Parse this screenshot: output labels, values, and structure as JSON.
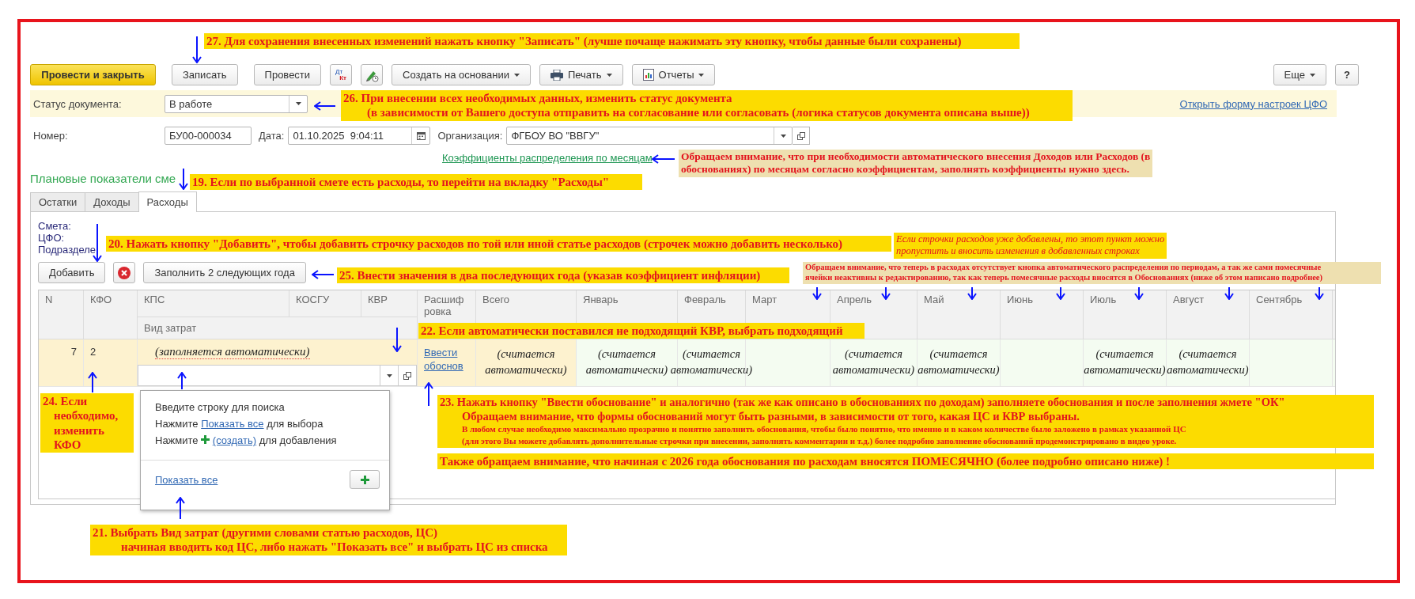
{
  "toolbar": {
    "buttons": [
      {
        "kind": "primary",
        "label": "Провести и закрыть"
      },
      {
        "kind": "plain",
        "label": "Записать"
      },
      {
        "kind": "plain",
        "label": "Провести"
      },
      {
        "kind": "entries",
        "top": "Дт",
        "bottom": "Кт"
      },
      {
        "kind": "pen"
      },
      {
        "kind": "menu",
        "label": "Создать на основании"
      },
      {
        "kind": "print",
        "label": "Печать"
      },
      {
        "kind": "reports",
        "label": "Отчеты"
      }
    ],
    "more": "Еще",
    "help": "?"
  },
  "status": {
    "label": "Статус документа:",
    "value": "В работе",
    "link": "Открыть форму настроек ЦФО"
  },
  "fields": {
    "number": {
      "label": "Номер:",
      "value": "БУ00-000034"
    },
    "date": {
      "label": "Дата:",
      "value": "01.10.2025  9:04:11"
    },
    "organization": {
      "label": "Организация:",
      "value": "ФГБОУ ВО \"ВВГУ\""
    }
  },
  "coefficients_link": "Коэффициенты распределения по месяцам",
  "section_title": "Плановые показатели сме",
  "tabs": [
    {
      "label": "Остатки",
      "selected": false
    },
    {
      "label": "Доходы",
      "selected": false
    },
    {
      "label": "Расходы",
      "selected": true
    }
  ],
  "panel": {
    "labels": [
      "Смета:",
      "ЦФО:",
      "Подразделе"
    ],
    "add_button": "Добавить",
    "fill_button": "Заполнить 2 следующих года"
  },
  "table": {
    "columns": [
      {
        "header": [
          "N"
        ]
      },
      {
        "header": [
          "КФО"
        ]
      },
      {
        "header": [
          "КПС"
        ]
      },
      {
        "header": [
          "КОСГУ"
        ]
      },
      {
        "header": [
          "КВР"
        ]
      },
      {
        "header": [
          "Расшиф",
          "ровка"
        ]
      }
    ],
    "subheader": "Вид затрат",
    "month_columns": [
      {
        "header": "Всего",
        "row_value": "(считается автоматически)"
      },
      {
        "header": "Январь",
        "row_value": "(считается автоматически)"
      },
      {
        "header": "Февраль",
        "row_value": "(считается автоматически)"
      },
      {
        "header": "Март"
      },
      {
        "header": "Апрель",
        "row_value": "(считается автоматически)"
      },
      {
        "header": "Май",
        "row_value": "(считается автоматически)"
      },
      {
        "header": "Июнь"
      },
      {
        "header": "Июль",
        "row_value": "(считается автоматически)"
      },
      {
        "header": "Август",
        "row_value": "(считается автоматически)"
      },
      {
        "header": "Сентябрь"
      }
    ],
    "row": {
      "n": "7",
      "kfo": "2",
      "expense_note": "(заполняется автоматически)",
      "detail_link": "Ввести обоснов"
    }
  },
  "dropdown": {
    "hint": "Введите строку для поиска",
    "show_prefix": "Нажмите",
    "show_link": "Показать все",
    "show_suffix": "для выбора",
    "create_prefix": "Нажмите",
    "create_link": "(создать)",
    "create_suffix": "для добавления",
    "footer_link": "Показать все"
  },
  "callouts": [
    {
      "kind": "note",
      "lines": [
        "27. Для сохранения внесенных изменений нажать кнопку \"Записать\" (лучше почаще нажимать эту кнопку, чтобы данные были сохранены)"
      ]
    },
    {
      "kind": "note",
      "lines": [
        "26. При внесении всех необходимых данных, изменить статус документа",
        "(в зависимости от Вашего доступа отправить на согласование или согласовать (логика статусов документа описана выше))"
      ]
    },
    {
      "kind": "remark",
      "lines": [
        "Обращаем внимание, что при необходимости автоматического внесения Доходов или Расходов (в",
        "обоснованиях) по месяцам согласно коэффициентам, заполнять коэффициенты нужно здесь."
      ]
    },
    {
      "kind": "note",
      "lines": [
        "19. Если по выбранной смете есть расходы, то перейти на вкладку \"Расходы\""
      ]
    },
    {
      "kind": "note",
      "lines": [
        "20. Нажать кнопку \"Добавить\", чтобы добавить строчку расходов по той или иной статье расходов (строчек можно добавить несколько)"
      ]
    },
    {
      "kind": "aside",
      "lines": [
        "Если строчки расходов уже добавлены, то этот пункт можно",
        "пропустить и вносить изменения в добавленных строках"
      ]
    },
    {
      "kind": "note",
      "lines": [
        "25. Внести значения в два последующих года (указав коэффициент инфляции)"
      ]
    },
    {
      "kind": "remark",
      "lines": [
        "Обращаем внимание, что теперь в расходах отсутствует кнопка автоматического распределения по периодам, а так же сами помесячные",
        "ячейки неактивны к редактированию, так как теперь помесячные расходы вносятся в Обоснованиях (ниже об этом написано подробнее)"
      ]
    },
    {
      "kind": "note",
      "lines": [
        "22. Если автоматически поставился не подходящий КВР, выбрать подходящий"
      ]
    },
    {
      "kind": "note",
      "lines": [
        "24. Если",
        "необходимо,",
        "изменить",
        "КФО"
      ]
    },
    {
      "kind": "note",
      "lines": [
        "23. Нажать кнопку \"Ввести обоснование\" и аналогично (так же как описано в обоснованиях по доходам) заполняете обоснования и после заполнения жмете \"ОК\"",
        "Обращаем внимание, что формы обоснований могут быть разными, в зависимости от того, какая ЦС и КВР выбраны."
      ],
      "detail_lines": [
        "В любом случае необходимо максимально прозрачно и понятно заполнить обоснования, чтобы было понятно, что именно и в каком количестве было заложено в рамках указанной ЦС",
        "(для этого Вы можете добавлять дополнительные строчки при внесении, заполнять комментарии и т.д.) более подробно заполнение обоснований продемонстрировано в видео уроке."
      ]
    },
    {
      "kind": "note",
      "lines": [
        "Также обращаем внимание, что начиная с 2026 года обоснования по расходам вносятся ПОМЕСЯЧНО (более подробно описано ниже) !"
      ]
    },
    {
      "kind": "note",
      "lines": [
        "21. Выбрать Вид затрат (другими словами статью расходов, ЦС)",
        "начиная вводить код ЦС, либо нажать \"Показать все\" и выбрать ЦС из списка"
      ]
    }
  ]
}
